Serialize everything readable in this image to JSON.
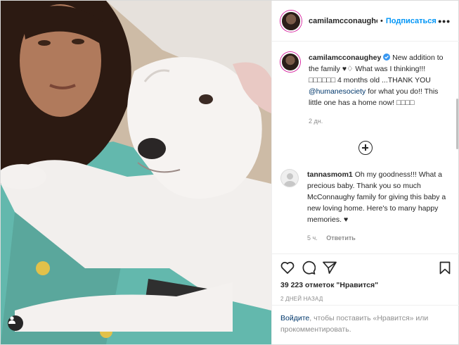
{
  "post": {
    "author": "camilamcconaughey",
    "author_truncated": "camilamcconaughe",
    "separator": "•",
    "follow_label": "Подписаться",
    "more_label": "•••"
  },
  "caption": {
    "username": "camilamcconaughey",
    "text_1": " New addition to the family ",
    "text_2": " What was I thinking!!! ",
    "text_3": " 4 months old ...THANK YOU ",
    "mention": "@humanesociety",
    "text_4": " for what you do!! This little one has a home now! ",
    "emoji_boxes_1": "□□□□□□",
    "emoji_boxes_2": "□□□□",
    "time": "2 дн."
  },
  "comment": {
    "username": "tannasmom1",
    "text": " Oh my goodness!!! What a precious baby. Thank you so much McConnaughy family for giving this baby a new loving home. Here's to many happy memories. ",
    "time": "5 ч.",
    "reply_label": "Ответить"
  },
  "likes_text": "39 223 отметок \"Нравится\"",
  "date_text": "2 ДНЕЙ НАЗАД",
  "login_prompt": {
    "link": "Войдите",
    "text": ", чтобы поставить «Нравится» или прокомментировать."
  },
  "icons": [
    "heart-icon",
    "comment-icon",
    "share-icon",
    "bookmark-icon",
    "more-icon",
    "add-comments-icon",
    "user-tag-icon",
    "verified-icon"
  ],
  "colors": {
    "accent": "#0095f6",
    "link": "#00376b",
    "muted": "#8e8e8e"
  }
}
